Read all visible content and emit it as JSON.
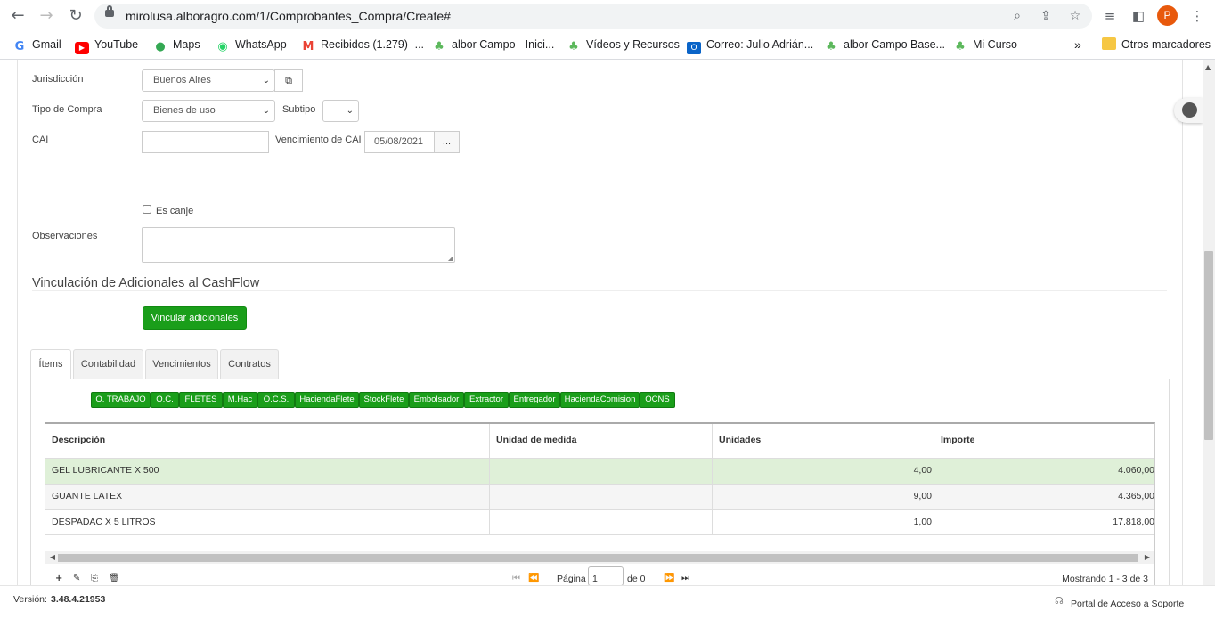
{
  "browser": {
    "url": "mirolusa.alboragro.com/1/Comprobantes_Compra/Create#",
    "profile_initial": "P",
    "bookmarks": [
      {
        "label": "Gmail",
        "icon": "google-icon"
      },
      {
        "label": "YouTube",
        "icon": "youtube-icon"
      },
      {
        "label": "Maps",
        "icon": "maps-pin-icon"
      },
      {
        "label": "WhatsApp",
        "icon": "whatsapp-icon"
      },
      {
        "label": "Recibidos (1.279) -...",
        "icon": "gmail-icon"
      },
      {
        "label": "albor Campo - Inici...",
        "icon": "sprout-icon"
      },
      {
        "label": "Vídeos y Recursos",
        "icon": "sprout-icon"
      },
      {
        "label": "Correo: Julio Adrián...",
        "icon": "outlook-icon"
      },
      {
        "label": "albor Campo Base...",
        "icon": "sprout-icon"
      },
      {
        "label": "Mi Curso",
        "icon": "sprout-icon"
      }
    ],
    "overflow": "»",
    "other_bookmarks": "Otros marcadores"
  },
  "form": {
    "jurisdiccion_label": "Jurisdicción",
    "jurisdiccion_value": "Buenos Aires",
    "tipo_compra_label": "Tipo de Compra",
    "tipo_compra_value": "Bienes de uso",
    "subtipo_label": "Subtipo",
    "subtipo_value": "",
    "cai_label": "CAI",
    "cai_value": "",
    "vencimiento_label": "Vencimiento de CAI",
    "vencimiento_value": "05/08/2021",
    "vencimiento_button": "...",
    "es_canje_label": "Es canje",
    "observaciones_label": "Observaciones"
  },
  "cashflow": {
    "title": "Vinculación de Adicionales al CashFlow",
    "button": "Vincular adicionales"
  },
  "tabs": [
    "Ítems",
    "Contabilidad",
    "Vencimientos",
    "Contratos"
  ],
  "chips": [
    "O. TRABAJO",
    "O.C.",
    "FLETES",
    "M.Hac",
    "O.C.S.",
    "HaciendaFlete",
    "StockFlete",
    "Embolsador",
    "Extractor",
    "Entregador",
    "HaciendaComision",
    "OCNS"
  ],
  "grid": {
    "headers": [
      "Descripción",
      "Unidad de medida",
      "Unidades",
      "Importe"
    ],
    "rows": [
      {
        "descripcion": "GEL LUBRICANTE X 500",
        "unidad": "",
        "unidades": "4,00",
        "importe": "4.060,00"
      },
      {
        "descripcion": "GUANTE LATEX",
        "unidad": "",
        "unidades": "9,00",
        "importe": "4.365,00"
      },
      {
        "descripcion": "DESPADAC X 5 LITROS",
        "unidad": "",
        "unidades": "1,00",
        "importe": "17.818,00"
      }
    ]
  },
  "pager": {
    "page_label": "Página",
    "page_value": "1",
    "of_label": "de 0",
    "showing": "Mostrando 1 - 3 de 3"
  },
  "footer": {
    "version_label": "Versión:",
    "version_value": "3.48.4.21953",
    "support": "Portal de Acceso a Soporte"
  },
  "colors": {
    "accent_green": "#1a9e1a",
    "selected_row": "#dff0d8"
  }
}
